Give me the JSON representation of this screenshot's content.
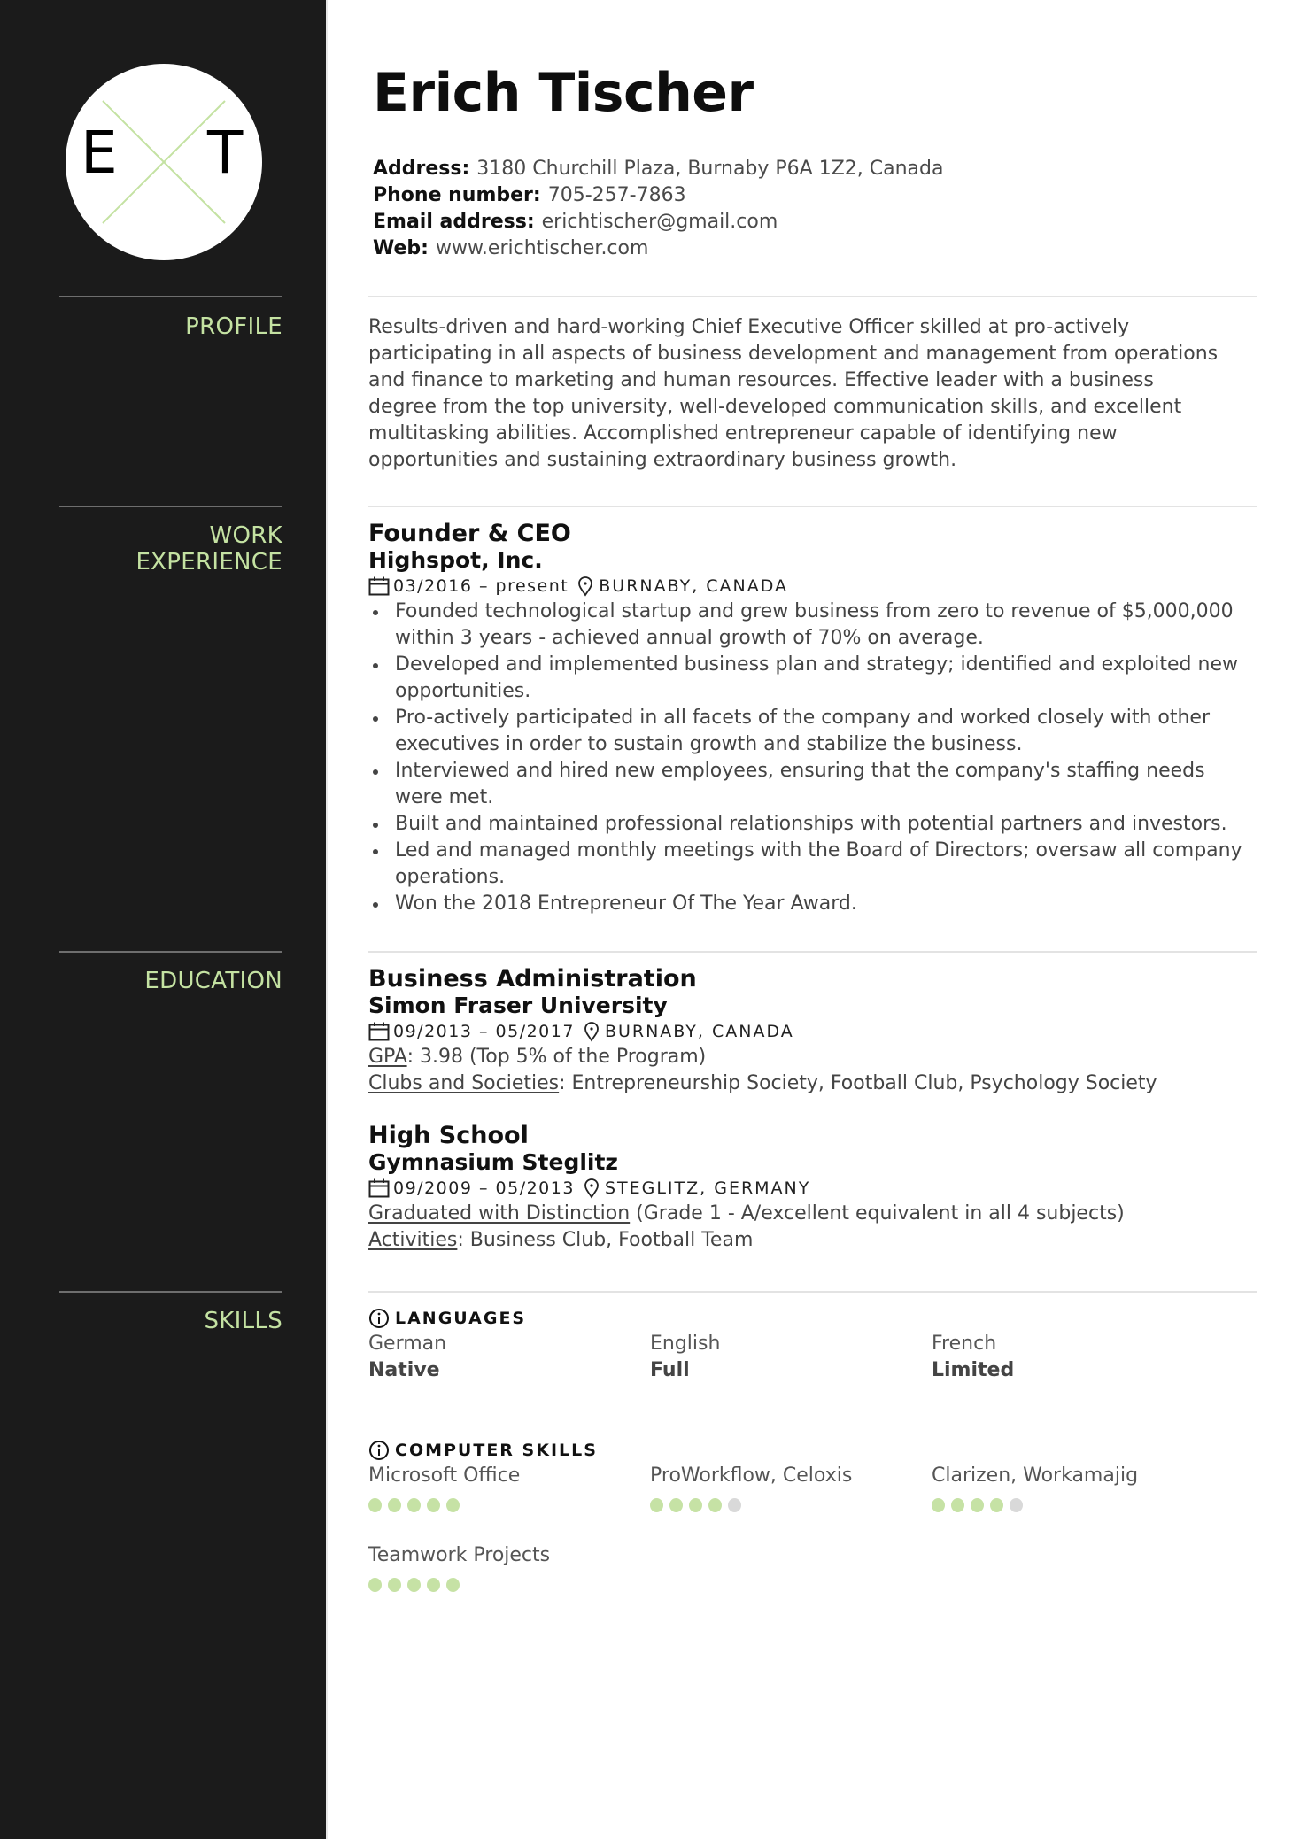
{
  "header": {
    "monogram": {
      "left_letter": "E",
      "right_letter": "T"
    },
    "name": "Erich Tischer",
    "contact": [
      {
        "label": "Address:",
        "value": "3180 Churchill Plaza, Burnaby P6A 1Z2, Canada"
      },
      {
        "label": "Phone number:",
        "value": "705-257-7863"
      },
      {
        "label": "Email address:",
        "value": "erichtischer@gmail.com"
      },
      {
        "label": "Web:",
        "value": "www.erichtischer.com"
      }
    ]
  },
  "sections": {
    "profile": "PROFILE",
    "work_line1": "WORK",
    "work_line2": "EXPERIENCE",
    "education": "EDUCATION",
    "skills": "SKILLS"
  },
  "profile": "Results-driven and hard-working Chief Executive Officer skilled at pro-actively participating in all aspects of business development and management from operations and finance to marketing and human resources. Effective leader with a business degree from the top university, well-developed communication skills, and excellent multitasking abilities. Accomplished entrepreneur capable of identifying new opportunities and sustaining extraordinary business growth.",
  "work": [
    {
      "title": "Founder & CEO",
      "company": "Highspot, Inc.",
      "dates": "03/2016 – present",
      "location": "BURNABY, CANADA",
      "bullets": [
        "Founded technological startup and grew business from zero to revenue of $5,000,000 within 3 years - achieved annual growth of 70% on average.",
        "Developed and implemented business plan and strategy; identified and exploited new opportunities.",
        "Pro-actively participated in all facets of the company and worked closely with other executives in order to sustain growth and stabilize the business.",
        "Interviewed and hired new employees, ensuring that the company's staffing needs were met.",
        "Built and maintained professional relationships with potential partners and investors.",
        "Led and managed monthly meetings with the Board of Directors; oversaw all company operations.",
        "Won the 2018 Entrepreneur Of The Year Award."
      ]
    }
  ],
  "education": [
    {
      "degree": "Business Administration",
      "school": "Simon Fraser University",
      "dates": "09/2013 – 05/2017",
      "location": "BURNABY, CANADA",
      "details": [
        {
          "label": "GPA",
          "text": ": 3.98 (Top 5% of the Program)"
        },
        {
          "label": "Clubs and Societies",
          "text": ": Entrepreneurship Society, Football Club, Psychology Society"
        }
      ]
    },
    {
      "degree": "High School",
      "school": "Gymnasium Steglitz",
      "dates": "09/2009 – 05/2013",
      "location": "STEGLITZ, GERMANY",
      "details": [
        {
          "label": "Graduated with Distinction",
          "text": " (Grade 1 - A/excellent equivalent in all 4 subjects)"
        },
        {
          "label": "Activities",
          "text": ": Business Club, Football Team"
        }
      ]
    }
  ],
  "skills": {
    "languages_heading": "LANGUAGES",
    "languages": [
      {
        "name": "German",
        "level": "Native"
      },
      {
        "name": "English",
        "level": "Full"
      },
      {
        "name": "French",
        "level": "Limited"
      }
    ],
    "computer_heading": "COMPUTER SKILLS",
    "computer": [
      {
        "name": "Microsoft Office",
        "rating": 5,
        "max": 5
      },
      {
        "name": "ProWorkflow, Celoxis",
        "rating": 4,
        "max": 5
      },
      {
        "name": "Clarizen, Workamajig",
        "rating": 4,
        "max": 5
      },
      {
        "name": "Teamwork Projects",
        "rating": 5,
        "max": 5
      }
    ]
  },
  "colors": {
    "sidebar": "#1b1b1b",
    "accent": "#c4e2a2",
    "dot_on": "#c6e2a5",
    "dot_off": "#d9d9d9"
  }
}
